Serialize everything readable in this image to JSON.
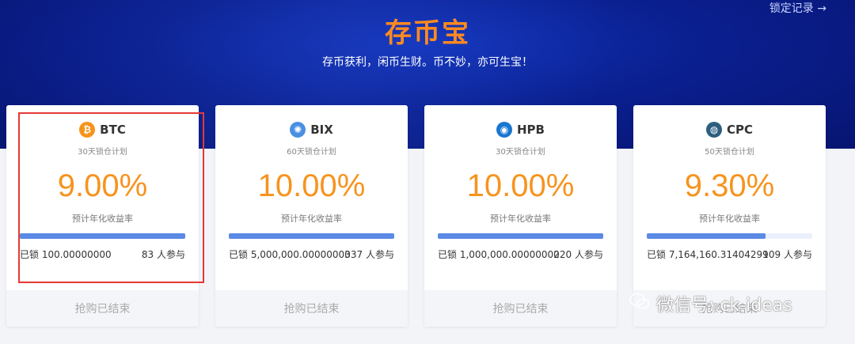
{
  "header": {
    "title": "存币宝",
    "subtitle": "存币获利，闲币生财。币不妙，亦可生宝！",
    "lock_records": "锁定记录 →"
  },
  "cards": [
    {
      "coin": "BTC",
      "icon": "btc-icon",
      "icon_color": "#f7931a",
      "plan": "30天锁仓计划",
      "rate": "9.00%",
      "rate_label": "预计年化收益率",
      "progress": 1.0,
      "locked": "已锁 100.00000000",
      "participants": "83 人参与",
      "status": "抢购已结束"
    },
    {
      "coin": "BIX",
      "icon": "bix-icon",
      "icon_color": "#4a90e2",
      "plan": "60天锁仓计划",
      "rate": "10.00%",
      "rate_label": "预计年化收益率",
      "progress": 1.0,
      "locked": "已锁 5,000,000.00000000",
      "participants": "337 人参与",
      "status": "抢购已结束"
    },
    {
      "coin": "HPB",
      "icon": "hpb-icon",
      "icon_color": "#1976d2",
      "plan": "30天锁仓计划",
      "rate": "10.00%",
      "rate_label": "预计年化收益率",
      "progress": 1.0,
      "locked": "已锁 1,000,000.00000000",
      "participants": "220 人参与",
      "status": "抢购已结束"
    },
    {
      "coin": "CPC",
      "icon": "cpc-icon",
      "icon_color": "#2c5f7f",
      "plan": "50天锁仓计划",
      "rate": "9.30%",
      "rate_label": "预计年化收益率",
      "progress": 0.716,
      "locked": "已锁 7,164,160.31404299",
      "participants": "109 人参与",
      "status": "抢购已结束"
    }
  ],
  "watermark": "微信号: ck-ideas",
  "colors": {
    "accent": "#f7931e",
    "progress": "#5b8ae6",
    "highlight": "#e53935"
  }
}
